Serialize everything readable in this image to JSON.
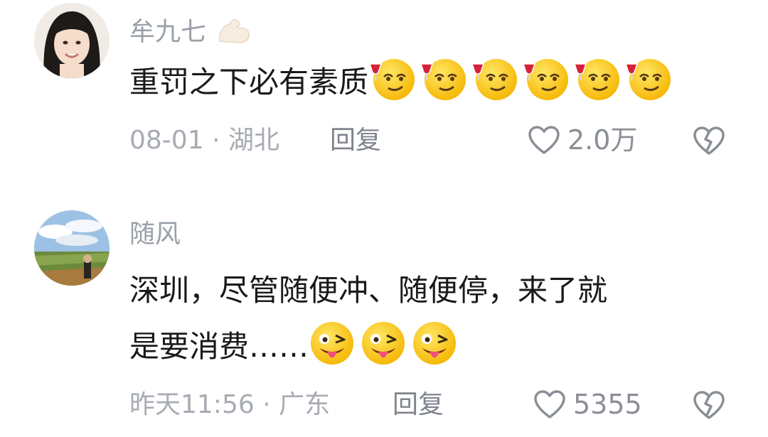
{
  "comments": [
    {
      "username": "牟九七",
      "username_badge_icon": "flexed-biceps-icon",
      "text": "重罚之下必有素质",
      "emoji": "wine-toast-relieved-face-emoji",
      "emoji_count": 6,
      "date": "08-01",
      "location": "湖北",
      "reply_label": "回复",
      "like_count": "2.0万"
    },
    {
      "username": "随风",
      "text_line1": "深圳，尽管随便冲、随便停，来了就",
      "text_line2": "是要消费……",
      "emoji": "winking-tongue-face-emoji",
      "emoji_count": 3,
      "date": "昨天11:56",
      "location": "广东",
      "reply_label": "回复",
      "like_count": "5355"
    }
  ],
  "separator": "·",
  "colors": {
    "username": "#9aa0a8",
    "text": "#1a1a1a",
    "meta": "#a7abb2",
    "icon": "#8a8f96"
  }
}
